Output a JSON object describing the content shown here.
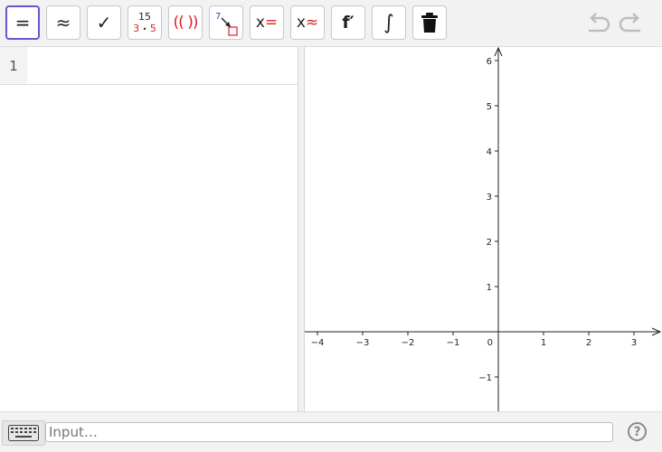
{
  "toolbar": {
    "buttons": [
      {
        "name": "evaluate",
        "glyph": "="
      },
      {
        "name": "numeric",
        "glyph": "≈"
      },
      {
        "name": "keep-input",
        "glyph": "✓"
      },
      {
        "name": "factor",
        "top": "15",
        "bottom_a": "3",
        "dot": "•",
        "bottom_b": "5"
      },
      {
        "name": "expand",
        "glyph": "(( ))"
      },
      {
        "name": "substitute",
        "top": "7"
      },
      {
        "name": "solve",
        "x": "x",
        "op": "="
      },
      {
        "name": "solve-numerically",
        "x": "x",
        "op": "≈"
      },
      {
        "name": "derivative",
        "glyph": "f′"
      },
      {
        "name": "integral",
        "glyph": "∫"
      },
      {
        "name": "delete",
        "icon": "trash-icon"
      }
    ],
    "undo_icon": "undo-icon",
    "redo_icon": "redo-icon"
  },
  "algebra": {
    "rows": [
      {
        "number": "1",
        "value": ""
      }
    ]
  },
  "graph": {
    "x_ticks": [
      "−4",
      "−3",
      "−2",
      "−1",
      "0",
      "1",
      "2",
      "3"
    ],
    "y_ticks": [
      "6",
      "5",
      "4",
      "3",
      "2",
      "1",
      "−1"
    ],
    "grid": false
  },
  "input_bar": {
    "placeholder": "Input…",
    "keyboard_icon": "keyboard-icon",
    "help_glyph": "?"
  },
  "colors": {
    "accent": "#6557d2",
    "red": "#e01e1e",
    "blue": "#3b3bd6"
  }
}
